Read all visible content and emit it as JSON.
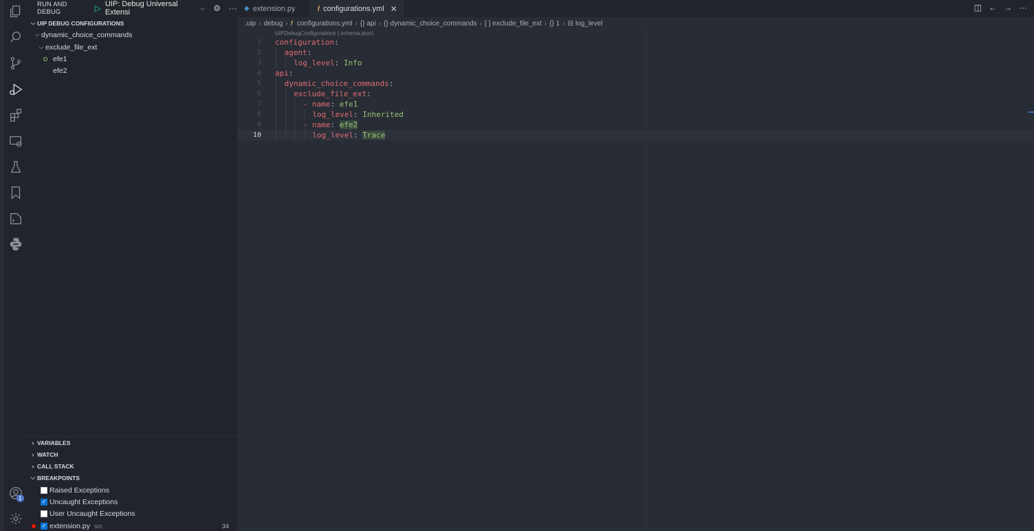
{
  "sidebar": {
    "header": {
      "title": "RUN AND DEBUG",
      "config": "UIP: Debug Universal Extensi"
    },
    "uip_section": {
      "title": "UIP DEBUG CONFIGURATIONS",
      "items": [
        "dynamic_choice_commands",
        "exclude_file_ext",
        "efe1",
        "efe2"
      ]
    },
    "sections": [
      "VARIABLES",
      "WATCH",
      "CALL STACK",
      "BREAKPOINTS"
    ],
    "breakpoints": [
      {
        "label": "Raised Exceptions",
        "checked": false
      },
      {
        "label": "Uncaught Exceptions",
        "checked": true
      },
      {
        "label": "User Uncaught Exceptions",
        "checked": false
      },
      {
        "label": "extension.py",
        "checked": true,
        "sub": "src",
        "line": "34"
      }
    ]
  },
  "activity_bar": {
    "icons": [
      "explorer-icon",
      "search-icon",
      "source-control-icon",
      "run-debug-icon",
      "extensions-icon",
      "remote-explorer-icon",
      "testing-icon",
      "bookmarks-icon",
      "terminal-icon",
      "python-icon",
      "accounts-icon",
      "settings-gear-icon"
    ],
    "accounts_badge": "1"
  },
  "tabs": [
    {
      "label": "extension.py",
      "active": false
    },
    {
      "label": "configurations.yml",
      "active": true
    }
  ],
  "breadcrumb": [
    ".uip",
    "debug",
    "configurations.yml",
    "{} api",
    "{} dynamic_choice_commands",
    "[ ] exclude_file_ext",
    "{} 1",
    "log_level"
  ],
  "schema_hint": "UIPDebugConfigurations (.schema.json)",
  "code": {
    "lines": [
      {
        "n": "1",
        "indent": 0,
        "key": "configuration",
        "value": ""
      },
      {
        "n": "2",
        "indent": 1,
        "key": "agent",
        "value": ""
      },
      {
        "n": "3",
        "indent": 2,
        "key": "log_level",
        "value": "Info"
      },
      {
        "n": "4",
        "indent": 0,
        "key": "api",
        "value": ""
      },
      {
        "n": "5",
        "indent": 1,
        "key": "dynamic_choice_commands",
        "value": ""
      },
      {
        "n": "6",
        "indent": 2,
        "key": "exclude_file_ext",
        "value": ""
      },
      {
        "n": "7",
        "indent": 3,
        "dash": true,
        "key": "name",
        "value": "efe1"
      },
      {
        "n": "8",
        "indent": 4,
        "key": "log_level",
        "value": "Inherited"
      },
      {
        "n": "9",
        "indent": 3,
        "dash": true,
        "key": "name",
        "value": "efe2",
        "hl": true
      },
      {
        "n": "10",
        "indent": 4,
        "key": "log_level",
        "value": "Trace",
        "hl": true,
        "current": true
      }
    ]
  },
  "colors": {
    "key": "#e06c75",
    "value": "#98c379",
    "background": "#282c34",
    "sidebar": "#21252b"
  }
}
